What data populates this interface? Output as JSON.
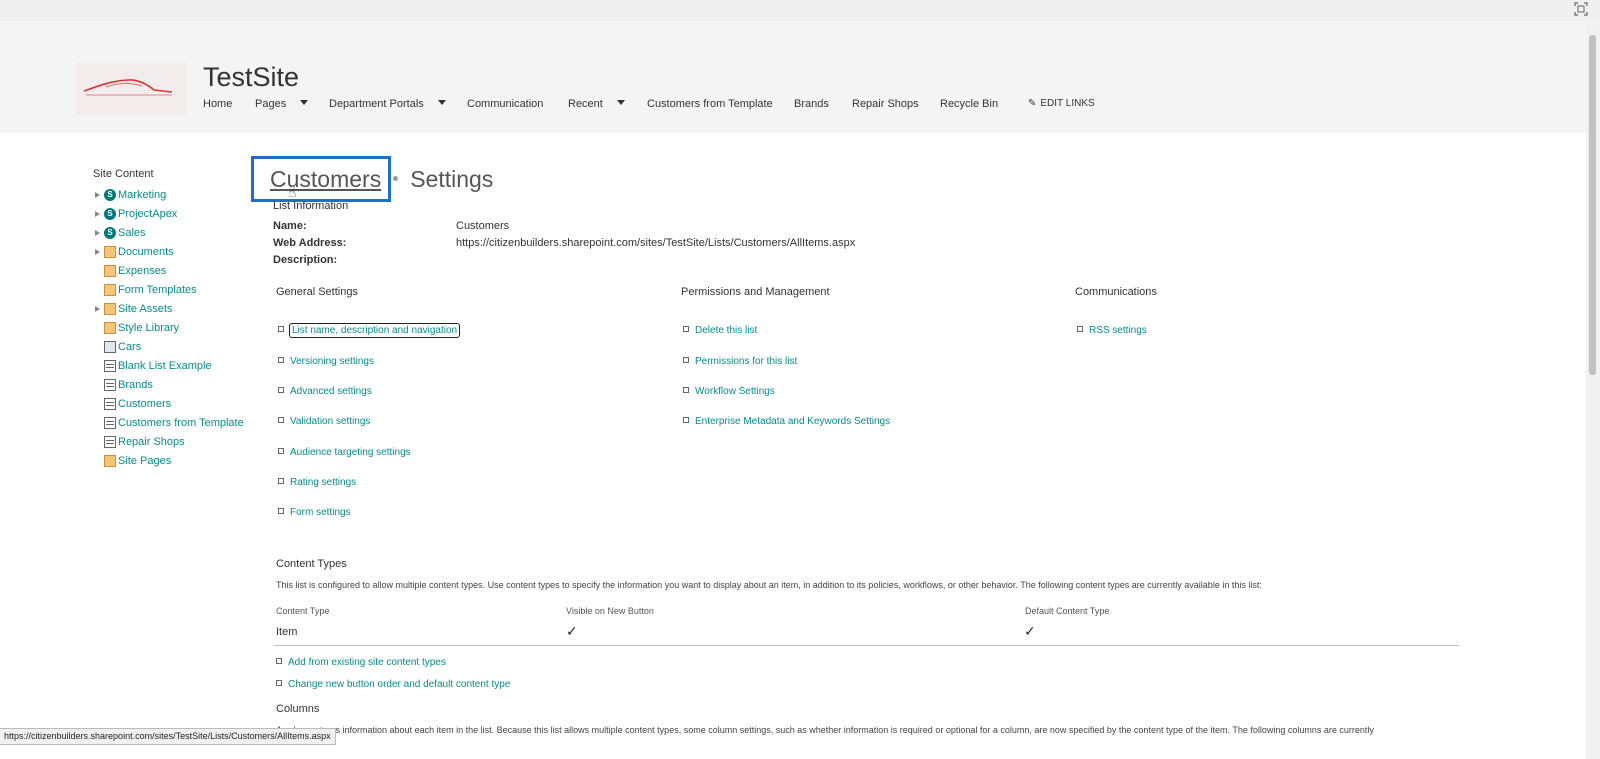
{
  "site": {
    "title": "TestSite"
  },
  "topnav": [
    {
      "label": "Home",
      "has_dropdown": false
    },
    {
      "label": "Pages",
      "has_dropdown": true
    },
    {
      "label": "Department Portals",
      "has_dropdown": true
    },
    {
      "label": "Communication",
      "has_dropdown": false
    },
    {
      "label": "Recent",
      "has_dropdown": true
    },
    {
      "label": "Customers from Template",
      "has_dropdown": false
    },
    {
      "label": "Brands",
      "has_dropdown": false
    },
    {
      "label": "Repair Shops",
      "has_dropdown": false
    },
    {
      "label": "Recycle Bin",
      "has_dropdown": false
    }
  ],
  "edit_links": "EDIT LINKS",
  "leftnav": {
    "header": "Site Content",
    "items": [
      {
        "label": "Marketing",
        "icon": "subsite-icon",
        "expandable": true
      },
      {
        "label": "ProjectApex",
        "icon": "subsite-icon",
        "expandable": true
      },
      {
        "label": "Sales",
        "icon": "subsite-icon",
        "expandable": true
      },
      {
        "label": "Documents",
        "icon": "library-icon",
        "expandable": true
      },
      {
        "label": "Expenses",
        "icon": "library-icon",
        "expandable": false
      },
      {
        "label": "Form Templates",
        "icon": "library-icon",
        "expandable": false
      },
      {
        "label": "Site Assets",
        "icon": "library-icon",
        "expandable": true
      },
      {
        "label": "Style Library",
        "icon": "library-icon",
        "expandable": false
      },
      {
        "label": "Cars",
        "icon": "picture-library-icon",
        "expandable": false
      },
      {
        "label": "Blank List Example",
        "icon": "list-icon",
        "expandable": false
      },
      {
        "label": "Brands",
        "icon": "list-icon",
        "expandable": false
      },
      {
        "label": "Customers",
        "icon": "list-icon",
        "expandable": false
      },
      {
        "label": "Customers from Template",
        "icon": "list-icon",
        "expandable": false
      },
      {
        "label": "Repair Shops",
        "icon": "list-icon",
        "expandable": false
      },
      {
        "label": "Site Pages",
        "icon": "library-icon",
        "expandable": false
      }
    ]
  },
  "breadcrumb": {
    "list": "Customers",
    "page": "Settings"
  },
  "list_info": {
    "heading": "List Information",
    "name_label": "Name:",
    "name_value": "Customers",
    "web_label": "Web Address:",
    "web_value": "https://citizenbuilders.sharepoint.com/sites/TestSite/Lists/Customers/AllItems.aspx",
    "desc_label": "Description:"
  },
  "general_settings": {
    "heading": "General Settings",
    "links": [
      "List name, description and navigation",
      "Versioning settings",
      "Advanced settings",
      "Validation settings",
      "Audience targeting settings",
      "Rating settings",
      "Form settings"
    ]
  },
  "permissions": {
    "heading": "Permissions and Management",
    "links": [
      "Delete this list",
      "Permissions for this list",
      "Workflow Settings",
      "Enterprise Metadata and Keywords Settings"
    ]
  },
  "communications": {
    "heading": "Communications",
    "links": [
      "RSS settings"
    ]
  },
  "content_types": {
    "heading": "Content Types",
    "description": "This list is configured to allow multiple content types. Use content types to specify the information you want to display about an item, in addition to its policies, workflows, or other behavior. The following content types are currently available in this list:",
    "columns": [
      "Content Type",
      "Visible on New Button",
      "Default Content Type"
    ],
    "rows": [
      {
        "name": "Item",
        "visible": "✓",
        "default": "✓"
      }
    ],
    "links": [
      "Add from existing site content types",
      "Change new button order and default content type"
    ]
  },
  "columns_section": {
    "heading": "Columns",
    "description": "A column stores information about each item in the list. Because this list allows multiple content types, some column settings, such as whether information is required or optional for a column, are now specified by the content type of the item. The following columns are currently"
  },
  "status_url": "https://citizenbuilders.sharepoint.com/sites/TestSite/Lists/Customers/AllItems.aspx",
  "colors": {
    "link": "#0a8a8a",
    "highlight": "#1f6fc5"
  }
}
